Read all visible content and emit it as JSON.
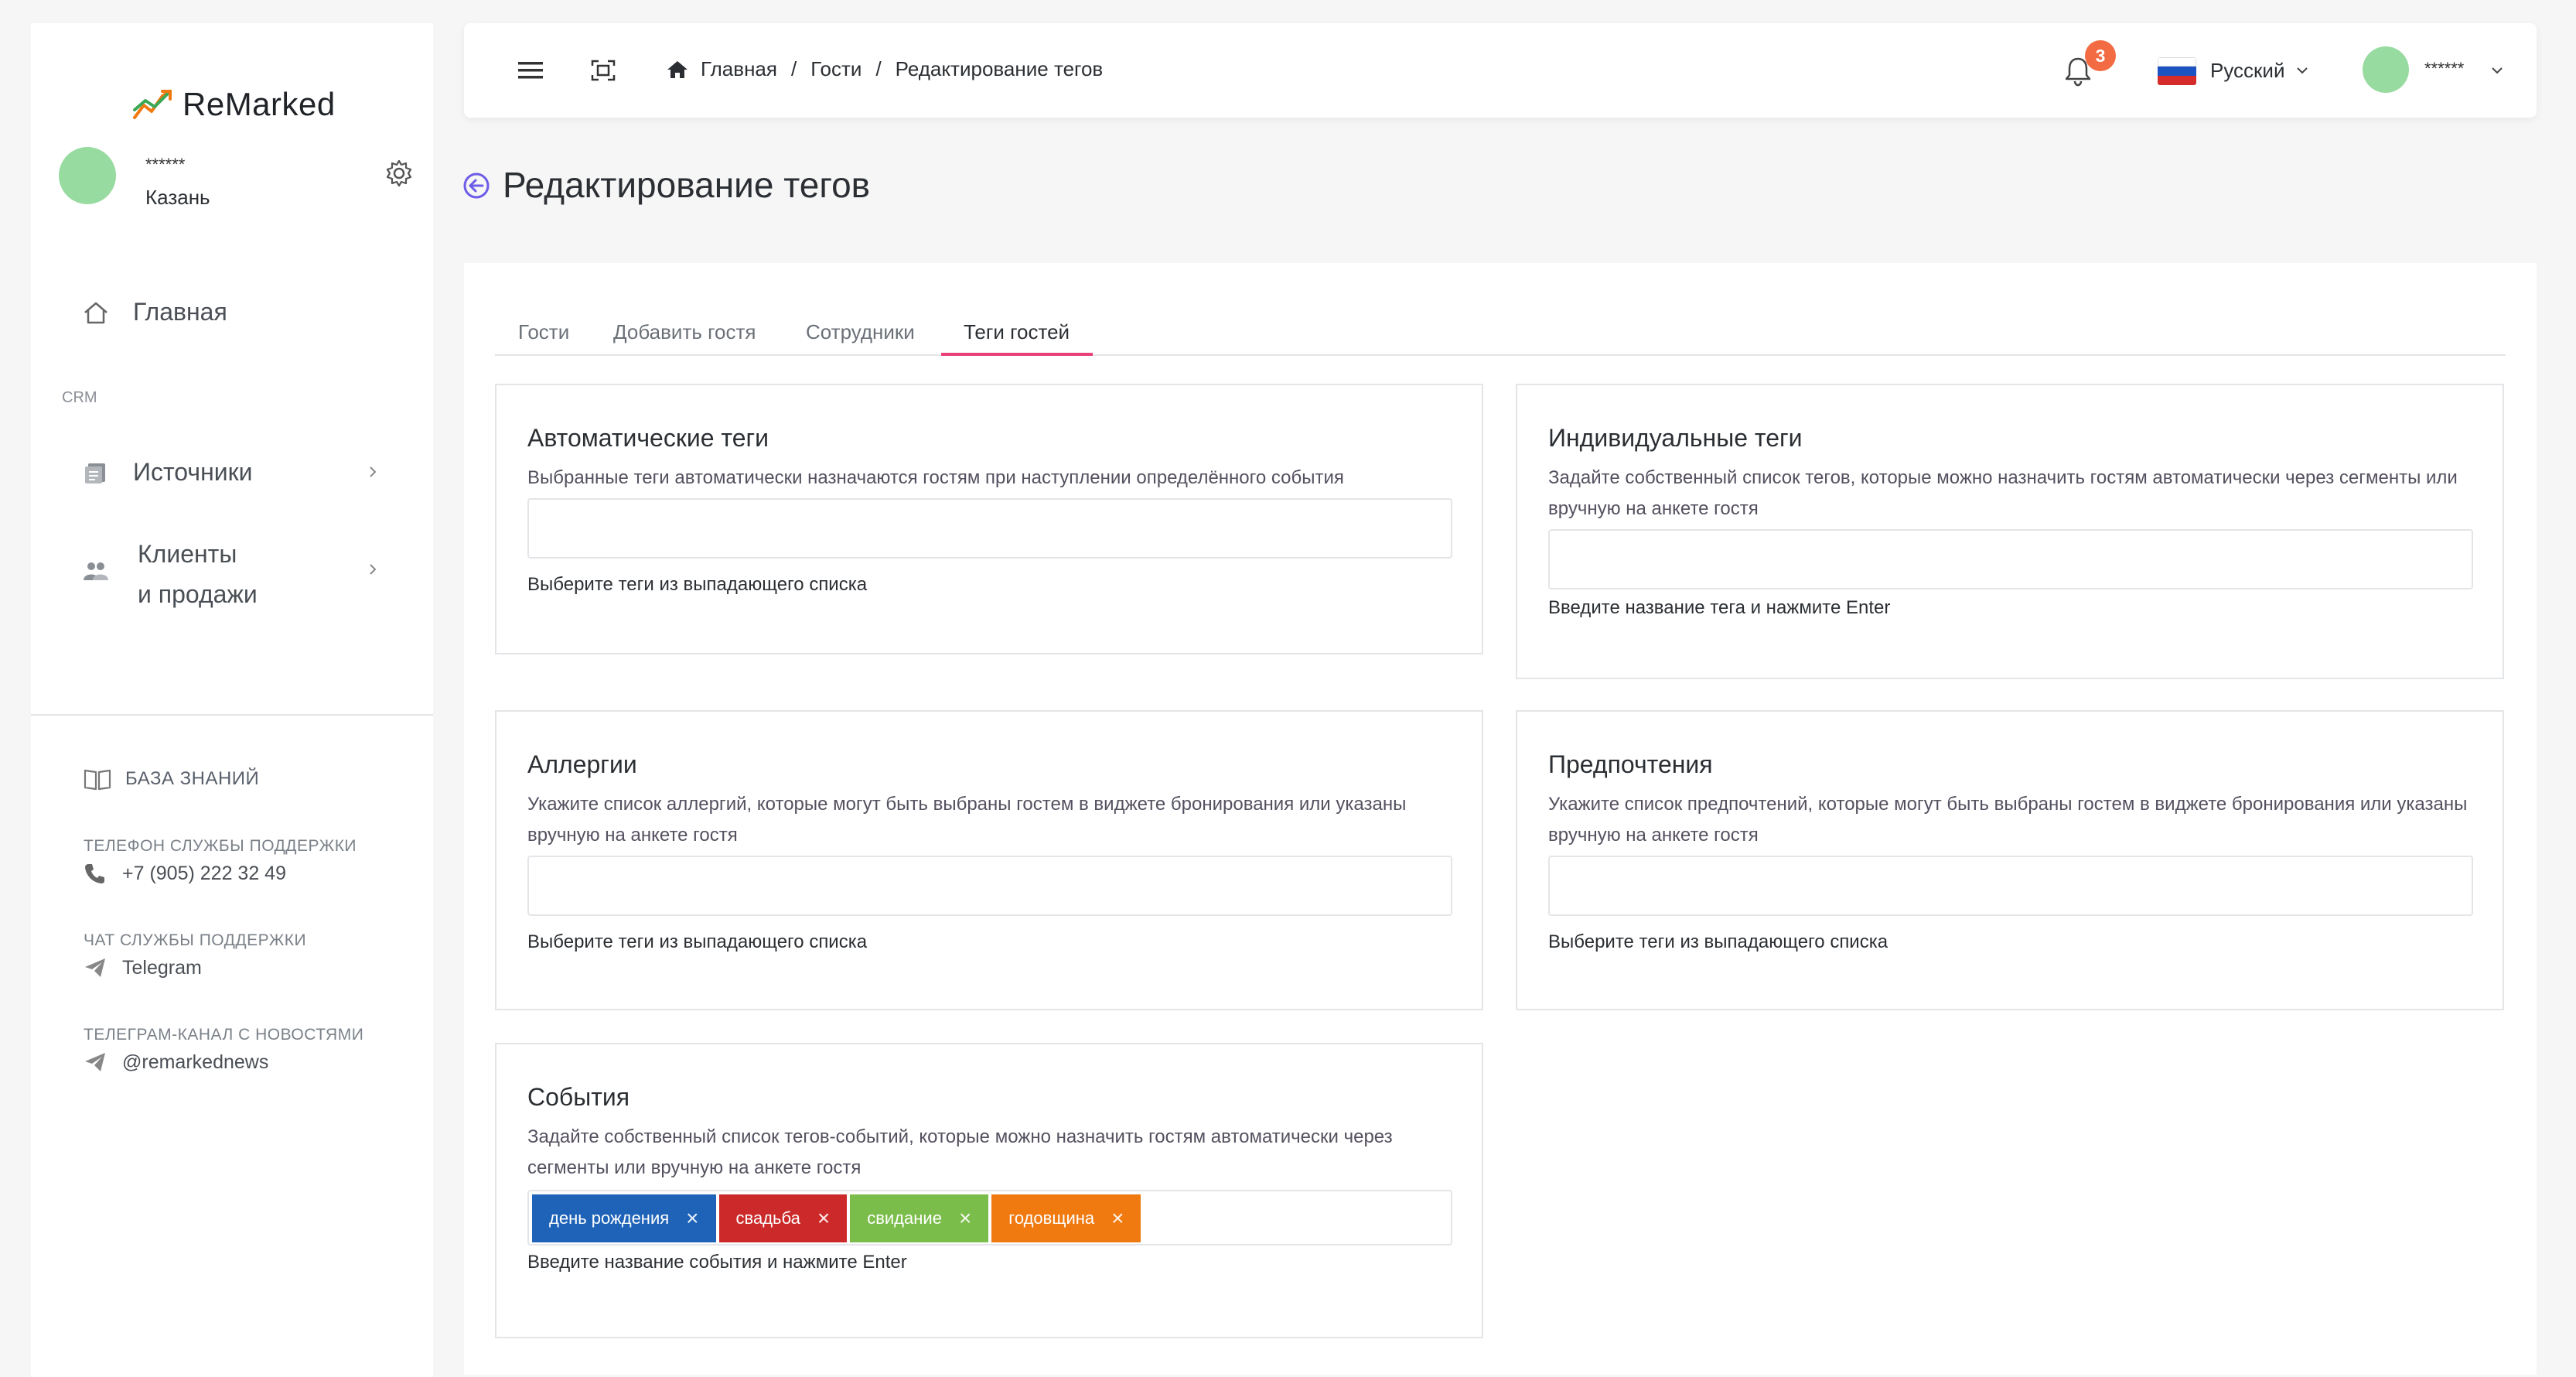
{
  "brand": {
    "name": "ReMarked"
  },
  "user": {
    "name": "******",
    "city": "Казань"
  },
  "sidebar": {
    "nav": [
      {
        "label": "Главная",
        "icon": "home-icon"
      },
      {
        "label": "Источники",
        "icon": "sources-icon"
      },
      {
        "label": "Клиенты\nи продажи",
        "label_line1": "Клиенты",
        "label_line2": "и продажи",
        "icon": "clients-icon"
      }
    ],
    "section_caption": "CRM",
    "knowledge_base": "БАЗА ЗНАНИЙ",
    "support": {
      "phone_caption": "ТЕЛЕФОН СЛУЖБЫ ПОДДЕРЖКИ",
      "phone": "+7 (905) 222 32 49",
      "chat_caption": "ЧАТ СЛУЖБЫ ПОДДЕРЖКИ",
      "chat": "Telegram",
      "channel_caption": "ТЕЛЕГРАМ-КАНАЛ С НОВОСТЯМИ",
      "channel": "@remarkednews"
    }
  },
  "topbar": {
    "breadcrumbs": [
      "Главная",
      "Гости",
      "Редактирование тегов"
    ],
    "separator": "/",
    "notifications": "3",
    "language": "Русский",
    "user": "******"
  },
  "page": {
    "title": "Редактирование тегов"
  },
  "tabs": [
    {
      "label": "Гости",
      "active": false
    },
    {
      "label": "Добавить гостя",
      "active": false
    },
    {
      "label": "Сотрудники",
      "active": false
    },
    {
      "label": "Теги гостей",
      "active": true
    }
  ],
  "cards": {
    "auto": {
      "title": "Автоматические теги",
      "desc": "Выбранные теги автоматически назначаются гостям при наступлении определённого события",
      "help": "Выберите теги из выпадающего списка"
    },
    "individual": {
      "title": "Индивидуальные теги",
      "desc": "Задайте собственный список тегов, которые можно назначить гостям автоматически через сегменты или вручную на анкете гостя",
      "help": "Введите название тега и нажмите Enter"
    },
    "allergies": {
      "title": "Аллергии",
      "desc": "Укажите список аллергий, которые могут быть выбраны гостем в виджете бронирования или указаны вручную на анкете гостя",
      "help": "Выберите теги из выпадающего списка"
    },
    "preferences": {
      "title": "Предпочтения",
      "desc": "Укажите список предпочтений, которые могут быть выбраны гостем в виджете бронирования или указаны вручную на анкете гостя",
      "help": "Выберите теги из выпадающего списка"
    },
    "events": {
      "title": "События",
      "desc": "Задайте собственный список тегов-событий, которые можно назначить гостям автоматически через сегменты или вручную на анкете гостя",
      "help": "Введите название события и нажмите Enter",
      "tags": [
        {
          "label": "день рождения",
          "color": "#1f63b8"
        },
        {
          "label": "свадьба",
          "color": "#cc2a2a"
        },
        {
          "label": "свидание",
          "color": "#7bbd4a"
        },
        {
          "label": "годовщина",
          "color": "#f07a10"
        }
      ],
      "remove_symbol": "×"
    }
  },
  "colors": {
    "accent_tab": "#e9407a",
    "back_arrow": "#6c5ce7",
    "badge": "#f26b43",
    "avatar": "#98dba0"
  }
}
